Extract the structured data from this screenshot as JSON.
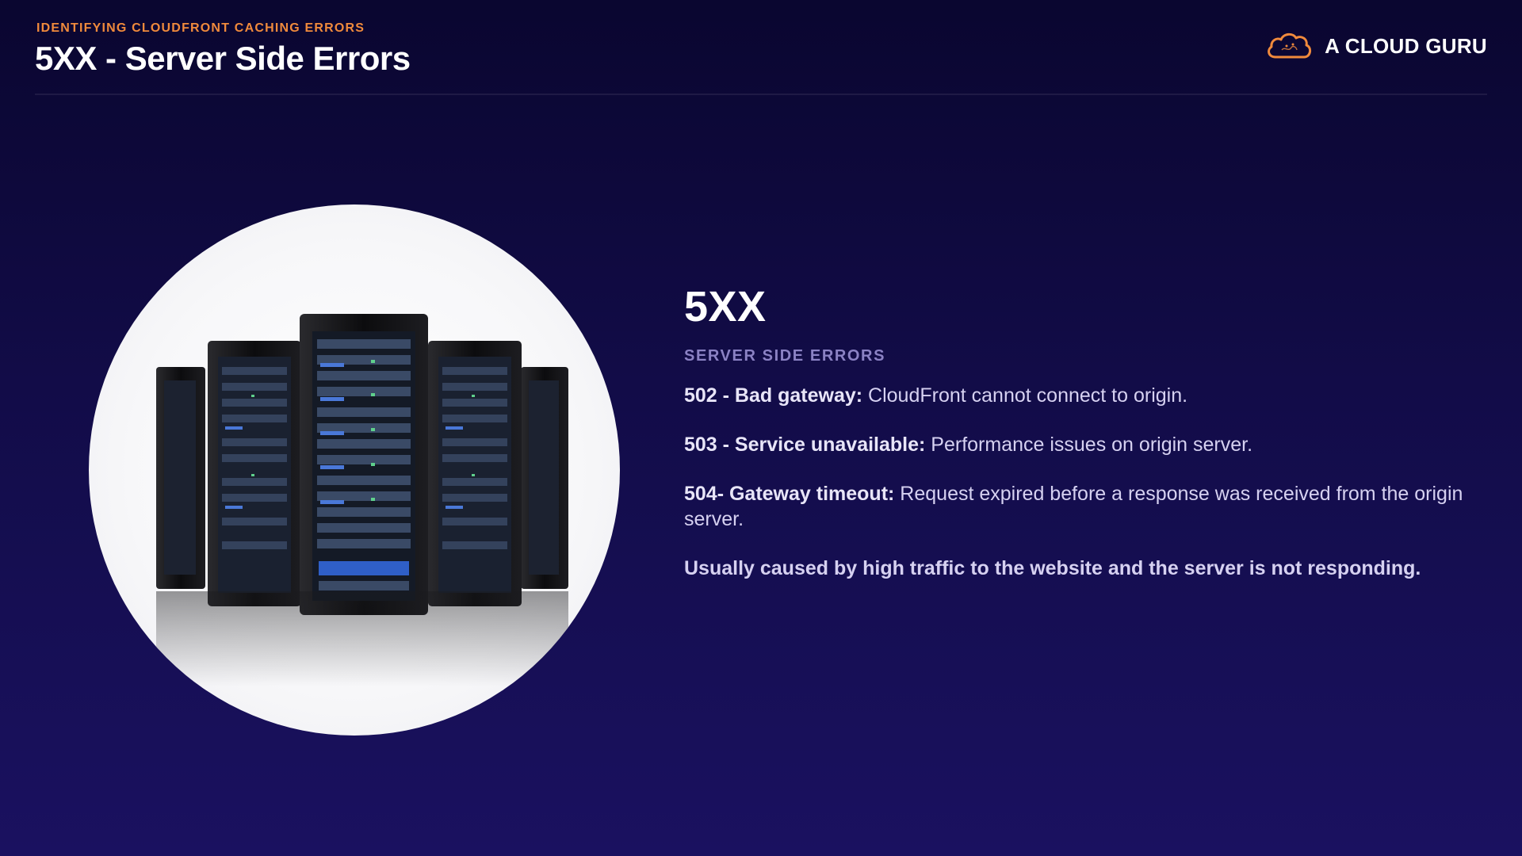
{
  "header": {
    "section_label": "IDENTIFYING CLOUDFRONT CACHING ERRORS",
    "title": "5XX - Server Side Errors",
    "brand_name": "A CLOUD GURU"
  },
  "content": {
    "heading": "5XX",
    "subheading": "SERVER SIDE ERRORS",
    "items": [
      {
        "lead": "502 - Bad gateway:",
        "text": " CloudFront cannot connect to origin."
      },
      {
        "lead": "503 - Service unavailable:",
        "text": " Performance issues on origin server."
      },
      {
        "lead": "504- Gateway timeout:",
        "text": " Request expired before a response was received from the origin server."
      }
    ],
    "note": "Usually caused by high traffic to the website and the server is not responding."
  },
  "hero": {
    "icon": "server-racks-icon"
  },
  "colors": {
    "background": "#120c48",
    "accent": "#f08a3c",
    "subheading": "#8b82c4",
    "body_text": "#d6d1f1"
  }
}
